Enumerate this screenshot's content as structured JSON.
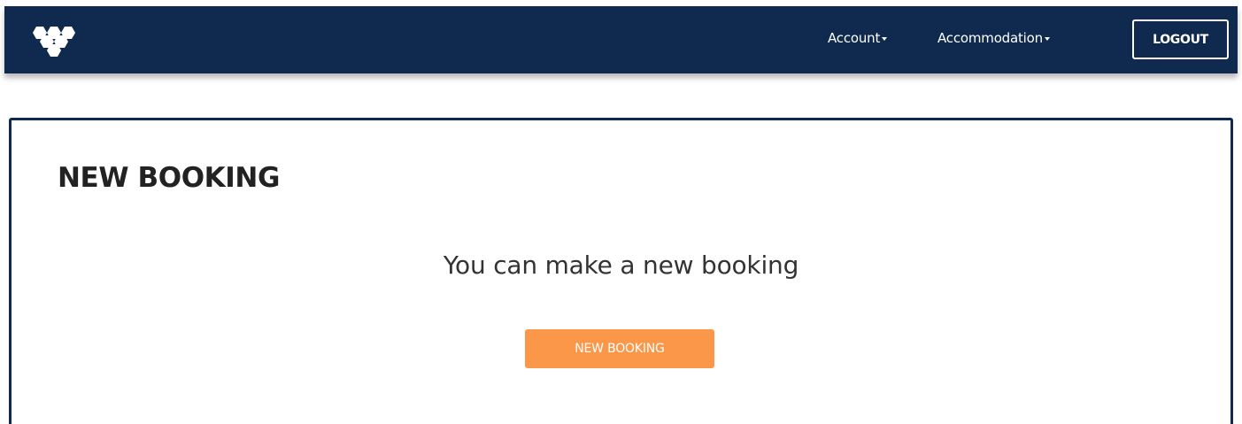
{
  "header": {
    "logo_icon": "hexagon-cluster-logo-icon",
    "nav": [
      {
        "label": "Account",
        "icon": "caret-down-icon"
      },
      {
        "label": "Accommodation",
        "icon": "caret-down-icon"
      }
    ],
    "logout_label": "LOGOUT"
  },
  "main": {
    "title": "NEW BOOKING",
    "message": "You can make a new booking",
    "button_label": "NEW BOOKING"
  },
  "colors": {
    "navbar": "#0f2a4e",
    "card_border": "#0f2a4e",
    "button_accent": "#fb9748",
    "text_light": "#ffffff"
  }
}
